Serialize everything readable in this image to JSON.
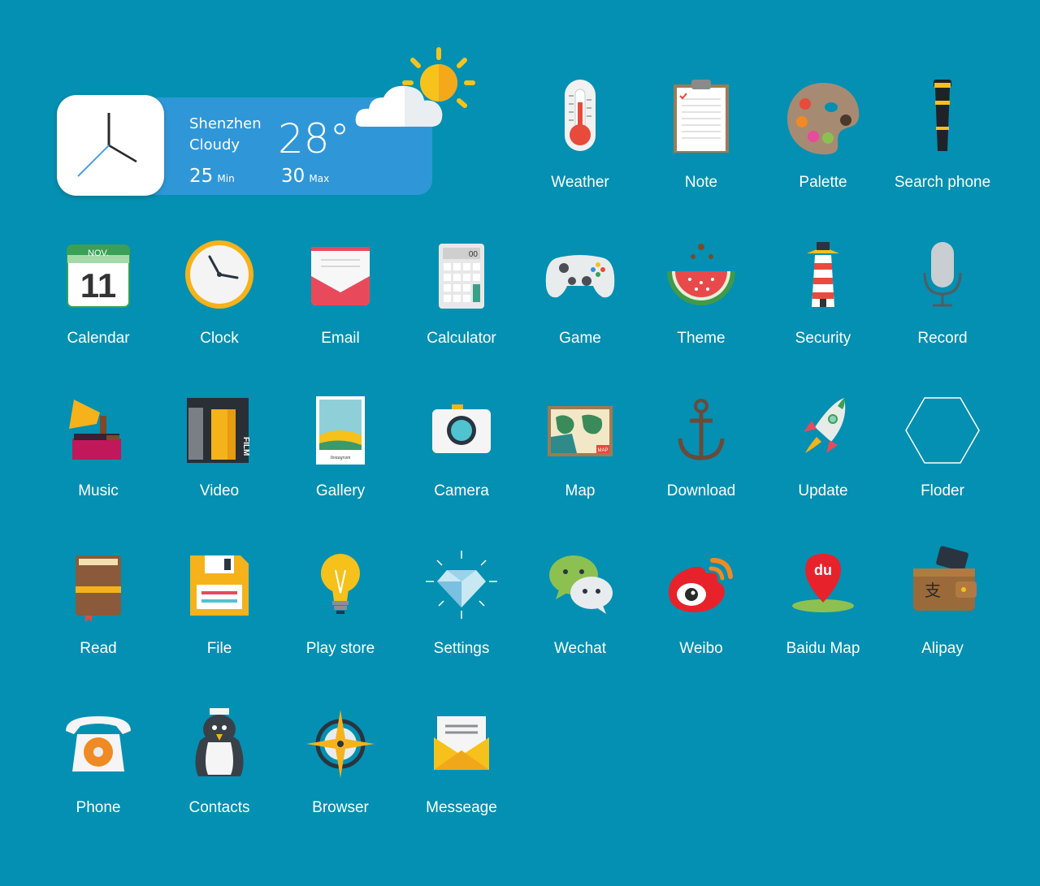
{
  "colors": {
    "background": "#0390b2",
    "widget_panel": "#2f97d8"
  },
  "weather_widget": {
    "city": "Shenzhen",
    "condition": "Cloudy",
    "temp": "28°",
    "min_value": "25",
    "min_unit": "Min",
    "max_value": "30",
    "max_unit": "Max"
  },
  "apps": [
    {
      "label": "Weather",
      "icon": "thermometer-icon"
    },
    {
      "label": "Note",
      "icon": "clipboard-icon"
    },
    {
      "label": "Palette",
      "icon": "palette-icon"
    },
    {
      "label": "Search phone",
      "icon": "telescope-icon"
    },
    {
      "label": "Calendar",
      "icon": "calendar-icon",
      "icon_month": "NOV.",
      "icon_day": "11"
    },
    {
      "label": "Clock",
      "icon": "clock-icon"
    },
    {
      "label": "Email",
      "icon": "envelope-icon"
    },
    {
      "label": "Calculator",
      "icon": "calculator-icon",
      "icon_display": "00"
    },
    {
      "label": "Game",
      "icon": "gamepad-icon"
    },
    {
      "label": "Theme",
      "icon": "watermelon-icon"
    },
    {
      "label": "Security",
      "icon": "lighthouse-icon"
    },
    {
      "label": "Record",
      "icon": "microphone-icon"
    },
    {
      "label": "Music",
      "icon": "gramophone-icon"
    },
    {
      "label": "Video",
      "icon": "film-icon",
      "icon_text": "FILM"
    },
    {
      "label": "Gallery",
      "icon": "polaroid-icon",
      "icon_caption": "Instagram"
    },
    {
      "label": "Camera",
      "icon": "camera-icon"
    },
    {
      "label": "Map",
      "icon": "world-map-icon",
      "icon_tag": "MAP"
    },
    {
      "label": "Download",
      "icon": "anchor-icon"
    },
    {
      "label": "Update",
      "icon": "rocket-icon"
    },
    {
      "label": "Floder",
      "icon": "hexagon-icon"
    },
    {
      "label": "Read",
      "icon": "book-icon"
    },
    {
      "label": "File",
      "icon": "floppy-disk-icon"
    },
    {
      "label": "Play store",
      "icon": "light-bulb-icon"
    },
    {
      "label": "Settings",
      "icon": "diamond-icon"
    },
    {
      "label": "Wechat",
      "icon": "chat-bubbles-icon"
    },
    {
      "label": "Weibo",
      "icon": "weibo-eye-icon"
    },
    {
      "label": "Baidu Map",
      "icon": "map-pin-icon",
      "icon_text": "du"
    },
    {
      "label": "Alipay",
      "icon": "wallet-icon",
      "icon_text": "支"
    },
    {
      "label": "Phone",
      "icon": "rotary-phone-icon"
    },
    {
      "label": "Contacts",
      "icon": "penguin-icon"
    },
    {
      "label": "Browser",
      "icon": "compass-icon"
    },
    {
      "label": "Messeage",
      "icon": "letter-icon"
    }
  ]
}
